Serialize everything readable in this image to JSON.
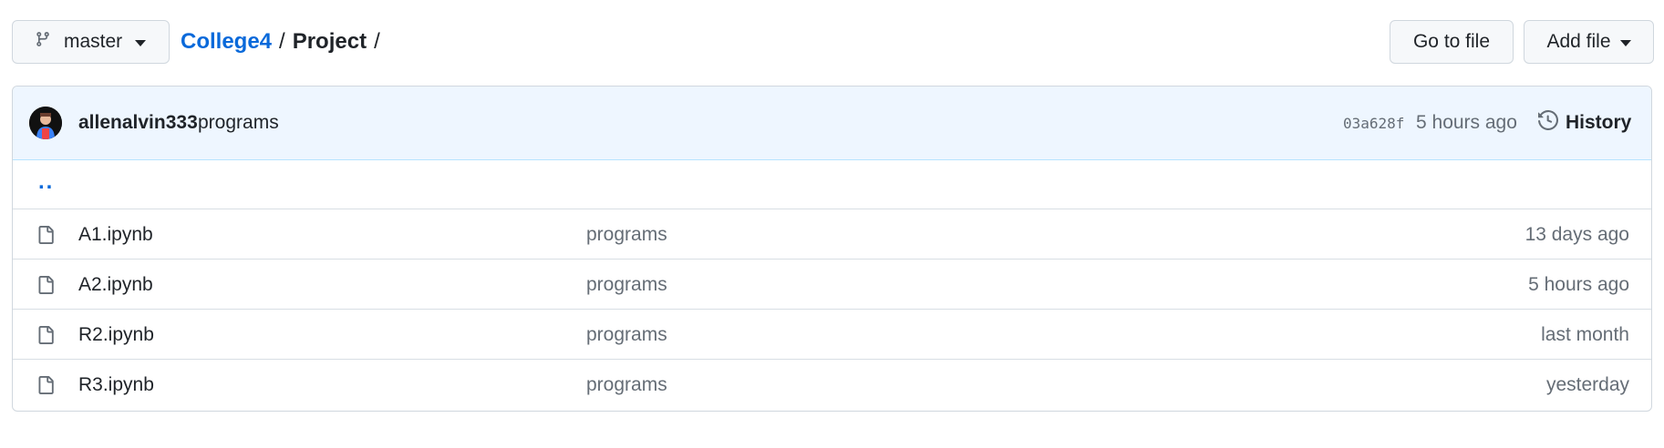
{
  "branch": {
    "name": "master"
  },
  "breadcrumb": {
    "repo": "College4",
    "sep1": "/",
    "folder": "Project",
    "sep2": "/"
  },
  "actions": {
    "go_to_file": "Go to file",
    "add_file": "Add file"
  },
  "commit": {
    "author": "allenalvin333",
    "message": "programs",
    "sha": "03a628f",
    "time": "5 hours ago",
    "history_label": "History"
  },
  "parent_dir": "..",
  "files": [
    {
      "name": "A1.ipynb",
      "message": "programs",
      "time": "13 days ago"
    },
    {
      "name": "A2.ipynb",
      "message": "programs",
      "time": "5 hours ago"
    },
    {
      "name": "R2.ipynb",
      "message": "programs",
      "time": "last month"
    },
    {
      "name": "R3.ipynb",
      "message": "programs",
      "time": "yesterday"
    }
  ],
  "icons": {
    "branch": "git-branch-icon",
    "caret": "triangle-down-icon",
    "history": "history-clock-icon",
    "file": "file-icon"
  },
  "colors": {
    "link": "#0969da",
    "commit_bg": "#eef6ff",
    "border": "#d0d7de",
    "muted": "#656d76"
  }
}
